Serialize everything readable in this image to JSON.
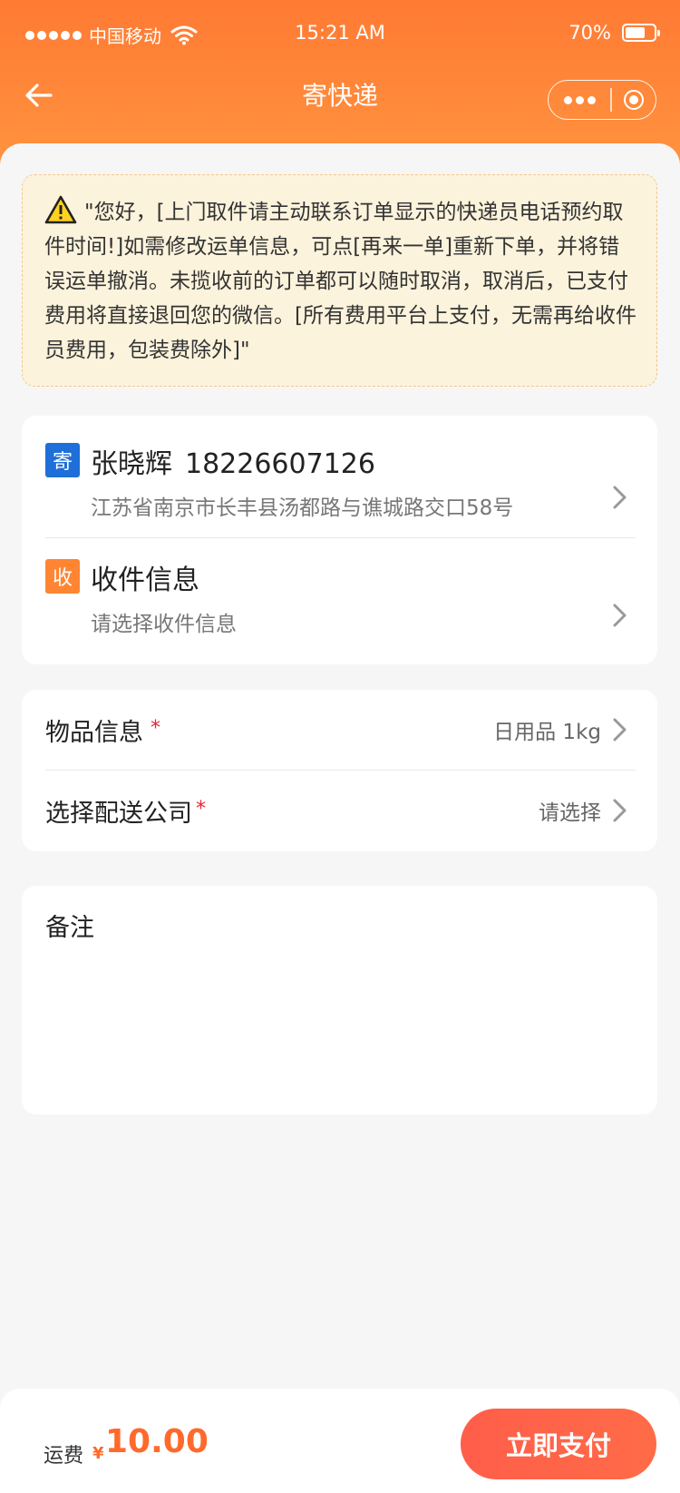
{
  "status_bar": {
    "carrier": "中国移动",
    "time": "15:21 AM",
    "battery": "70%",
    "battery_level": 0.7
  },
  "nav": {
    "title": "寄快递"
  },
  "notice": {
    "text": "\"您好，[上门取件请主动联系订单显示的快递员电话预约取件时间!]如需修改运单信息，可点[再来一单]重新下单，并将错误运单撤消。未揽收前的订单都可以随时取消，取消后，已支付费用将直接退回您的微信。[所有费用平台上支付，无需再给收件员费用，包装费除外]\""
  },
  "sender": {
    "tag": "寄",
    "name": "张晓辉",
    "phone": "18226607126",
    "address": "江苏省南京市长丰县汤都路与谯城路交口58号"
  },
  "receiver": {
    "tag": "收",
    "title": "收件信息",
    "placeholder": "请选择收件信息"
  },
  "goods": {
    "label": "物品信息",
    "required": "*",
    "value": "日用品  1kg"
  },
  "courier": {
    "label": "选择配送公司",
    "required": "*",
    "value": "请选择"
  },
  "remark": {
    "label": "备注",
    "value": ""
  },
  "footer": {
    "fee_label": "运费",
    "currency": "¥",
    "amount": "10.00",
    "pay_label": "立即支付"
  },
  "colors": {
    "brand": "#ff7a33",
    "accent": "#ff6a2c",
    "sender_tag": "#1e6fd9",
    "receiver_tag": "#ff8533"
  }
}
